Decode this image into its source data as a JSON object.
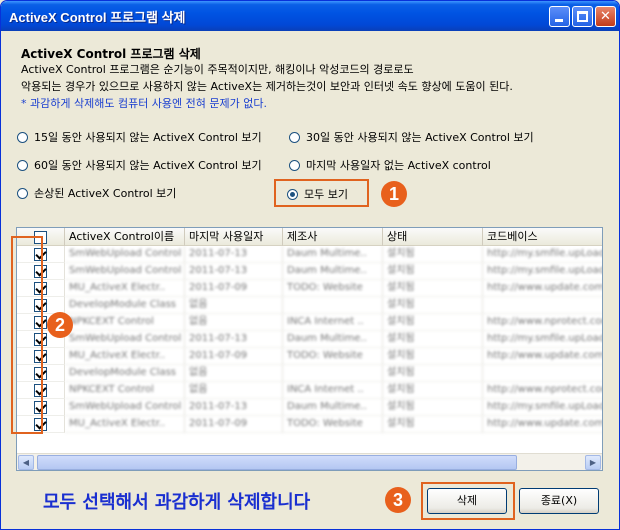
{
  "window": {
    "title": "ActiveX Control 프로그램 삭제"
  },
  "header": {
    "title": "ActiveX Control 프로그램 삭제",
    "line1": "ActiveX Control 프로그램은 순기능이 주목적이지만, 해킹이나 악성코드의 경로로도",
    "line2": "악용되는 경우가 있으므로 사용하지 않는 ActiveX는 제거하는것이 보안과 인터넷 속도 향상에 도움이 된다.",
    "note": "* 과감하게 삭제해도 컴퓨터 사용엔 전혀 문제가 없다."
  },
  "filters": [
    {
      "label": "15일 동안 사용되지 않는 ActiveX Control 보기",
      "checked": false
    },
    {
      "label": "30일 동안 사용되지 않는 ActiveX Control 보기",
      "checked": false
    },
    {
      "label": "60일 동안 사용되지 않는 ActiveX Control 보기",
      "checked": false
    },
    {
      "label": "마지막 사용일자 없는 ActiveX control",
      "checked": false
    },
    {
      "label": "손상된 ActiveX Control 보기",
      "checked": false
    },
    {
      "label": "모두 보기",
      "checked": true
    }
  ],
  "annotations": {
    "badge1": "1",
    "badge2": "2",
    "badge3": "3",
    "footer_text": "모두 선택해서 과감하게 삭제합니다"
  },
  "table": {
    "columns": [
      "",
      "ActiveX Control이름",
      "마지막 사용일자",
      "제조사",
      "상태",
      "코드베이스"
    ],
    "rows": [
      [
        "SmWebUpload Control",
        "2011-07-13",
        "Daum Multime..",
        "설치됨",
        "http://my.smfile.upLoad"
      ],
      [
        "SmWebUpload Control",
        "2011-07-13",
        "Daum Multime..",
        "설치됨",
        "http://my.smfile.upLoad"
      ],
      [
        "MU_ActiveX Electr..",
        "2011-07-09",
        "TODO: Website",
        "설치됨",
        "http://www.update.com/"
      ],
      [
        "DevelopModule Class",
        "없음",
        "",
        "설치됨",
        ""
      ],
      [
        "NPKCEXT Control",
        "없음",
        "INCA Internet ..",
        "설치됨",
        "http://www.nprotect.com/"
      ],
      [
        "SmWebUpload Control",
        "2011-07-13",
        "Daum Multime..",
        "설치됨",
        "http://my.smfile.upLoad"
      ],
      [
        "MU_ActiveX Electr..",
        "2011-07-09",
        "TODO: Website",
        "설치됨",
        "http://www.update.com/"
      ],
      [
        "DevelopModule Class",
        "없음",
        "",
        "설치됨",
        ""
      ],
      [
        "NPKCEXT Control",
        "없음",
        "INCA Internet ..",
        "설치됨",
        "http://www.nprotect.com/"
      ],
      [
        "SmWebUpload Control",
        "2011-07-13",
        "Daum Multime..",
        "설치됨",
        "http://my.smfile.upLoad"
      ],
      [
        "MU_ActiveX Electr..",
        "2011-07-09",
        "TODO: Website",
        "설치됨",
        "http://www.update.com/"
      ]
    ]
  },
  "buttons": {
    "delete": "삭제",
    "close": "종료(X)"
  },
  "colors": {
    "accent_orange": "#e0631f",
    "note_blue": "#1a3fd0",
    "titlebar_blue": "#0054e3"
  }
}
